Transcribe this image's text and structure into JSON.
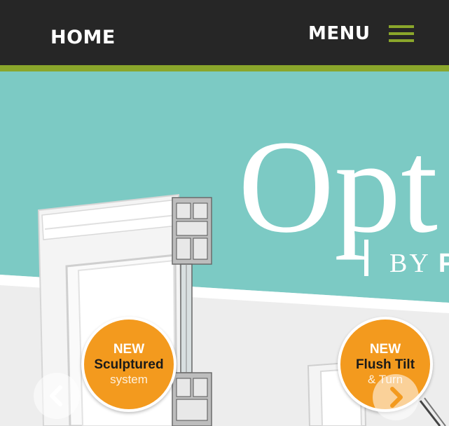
{
  "header": {
    "home_label": "HOME",
    "menu_label": "MENU",
    "menu_icon": "hamburger-icon"
  },
  "hero": {
    "brand_title": "Opt",
    "brand_sub_prefix": "BY ",
    "brand_sub_bold": "P"
  },
  "badges": [
    {
      "new": "NEW",
      "main": "Sculptured",
      "sub": "system"
    },
    {
      "new": "NEW",
      "main": "Flush Tilt",
      "sub": "& Turn"
    }
  ],
  "carousel": {
    "prev_icon": "chevron-left-icon",
    "next_icon": "chevron-right-icon"
  },
  "colors": {
    "header_bg": "#262626",
    "accent_green": "#8aa62b",
    "hero_teal": "#7ccac4",
    "badge_orange": "#f39a1e",
    "arrow_orange": "#f39a1e"
  }
}
